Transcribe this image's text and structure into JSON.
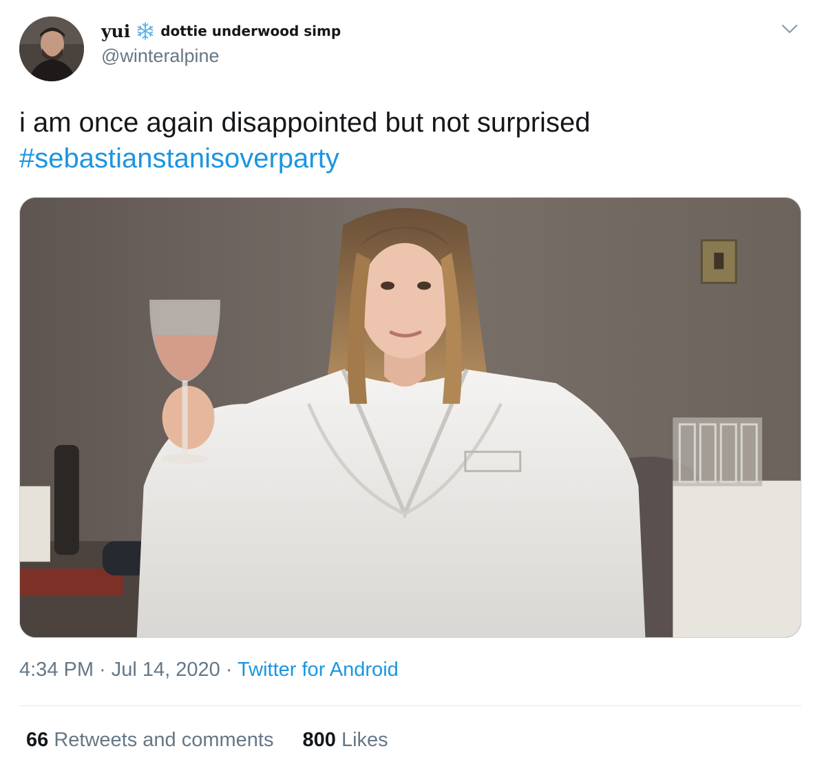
{
  "tweet": {
    "author": {
      "display_name": "yui",
      "name_emoji": "snowflake-icon",
      "name_suffix": "dottie underwood simp",
      "handle": "@winteralpine"
    },
    "text": "i am once again disappointed but not surprised",
    "hashtag": "#sebastianstanisoverparty",
    "timestamp": "4:34 PM · Jul 14, 2020",
    "separator": " · ",
    "source": "Twitter for Android",
    "stats": {
      "retweets_count": "66",
      "retweets_label": "Retweets and comments",
      "likes_count": "800",
      "likes_label": "Likes"
    },
    "colors": {
      "link": "#1b95e0",
      "secondary_text": "#657786",
      "primary_text": "#14171a",
      "divider": "#e1e8ed"
    }
  }
}
